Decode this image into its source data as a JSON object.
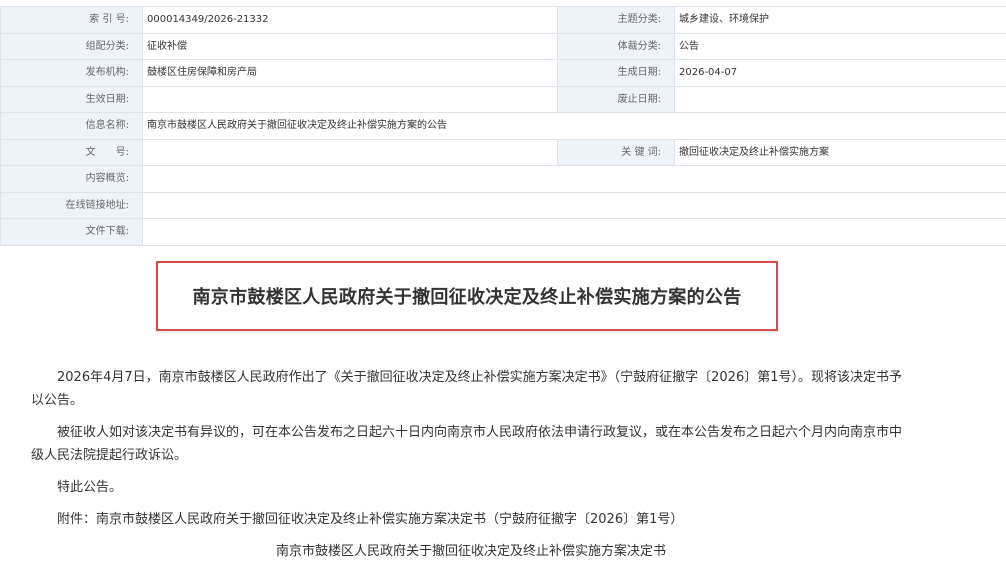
{
  "meta": {
    "index_no_label": "索 引 号:",
    "index_no": "000014349/2026-21332",
    "topic_label": "主题分类:",
    "topic": "城乡建设、环境保护",
    "org_class_label": "组配分类:",
    "org_class": "征收补偿",
    "genre_label": "体裁分类:",
    "genre": "公告",
    "publisher_label": "发布机构:",
    "publisher": "鼓楼区住房保障和房产局",
    "created_label": "生成日期:",
    "created": "2026-04-07",
    "effective_label": "生效日期:",
    "effective": "",
    "expire_label": "废止日期:",
    "expire": "",
    "info_name_label": "信息名称:",
    "info_name": "南京市鼓楼区人民政府关于撤回征收决定及终止补偿实施方案的公告",
    "doc_no_label": "文　　号:",
    "doc_no": "",
    "keywords_label": "关 键 词:",
    "keywords": "撤回征收决定及终止补偿实施方案",
    "summary_label": "内容概览:",
    "summary": "",
    "online_link_label": "在线链接地址:",
    "online_link": "",
    "download_label": "文件下载:",
    "download": ""
  },
  "title": "南京市鼓楼区人民政府关于撤回征收决定及终止补偿实施方案的公告",
  "paragraphs": [
    "2026年4月7日，南京市鼓楼区人民政府作出了《关于撤回征收决定及终止补偿实施方案决定书》（宁鼓府征撤字〔2026〕第1号）。现将该决定书予以公告。",
    "被征收人如对该决定书有异议的，可在本公告发布之日起六十日内向南京市人民政府依法申请行政复议，或在本公告发布之日起六个月内向南京市中级人民法院提起行政诉讼。",
    "特此公告。",
    "附件：南京市鼓楼区人民政府关于撤回征收决定及终止补偿实施方案决定书（宁鼓府征撤字〔2026〕第1号）"
  ],
  "attachment_heading": "南京市鼓楼区人民政府关于撤回征收决定及终止补偿实施方案决定书",
  "colors": {
    "label_bg": "#eef3fa",
    "border": "#dfe4ec",
    "title_border": "#d94a4a"
  }
}
